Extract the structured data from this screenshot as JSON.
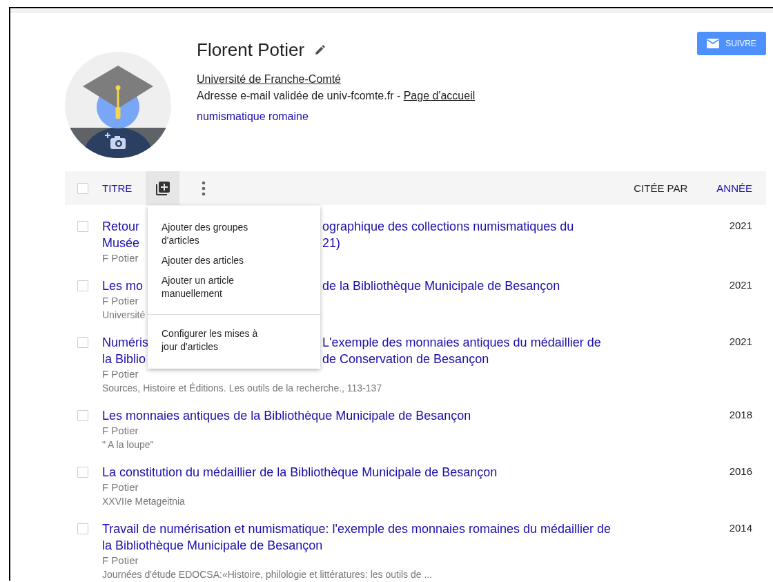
{
  "profile": {
    "name": "Florent Potier",
    "affiliation": "Université de Franche-Comté",
    "email_note": "Adresse e-mail validée de univ-fcomte.fr - ",
    "homepage_link": "Page d'accueil",
    "interest": "numismatique romaine"
  },
  "follow_button": {
    "label": "SUIVRE"
  },
  "table_header": {
    "select_all_checked": false,
    "title": "TITRE",
    "cited_by": "CITÉE PAR",
    "year": "ANNÉE"
  },
  "add_menu": {
    "groups": [
      [
        "Ajouter des groupes d'articles",
        "Ajouter des articles",
        "Ajouter un article manuellement"
      ],
      [
        "Configurer les mises à jour d'articles"
      ]
    ]
  },
  "articles": [
    {
      "checked": false,
      "title_segments": [
        {
          "before": "Retour",
          "after": "ographique des collections numismatiques du"
        },
        {
          "before": "Musée",
          "after": "21)"
        }
      ],
      "authors": "F Potier",
      "year": "2021"
    },
    {
      "checked": false,
      "title_segments": [
        {
          "before": "Les mo",
          "after": "de la Bibliothèque Municipale de Besançon"
        }
      ],
      "authors": "F Potier",
      "venue": "Université",
      "year": "2021"
    },
    {
      "checked": false,
      "title_segments": [
        {
          "before": "Numéris",
          "after": "L'exemple des monnaies antiques du médaillier de"
        },
        {
          "before": "la Biblio",
          "after": "de Conservation de Besançon"
        }
      ],
      "authors": "F Potier",
      "venue": "Sources, Histoire et Éditions. Les outils de la recherche., 113-137",
      "year": "2021"
    },
    {
      "checked": false,
      "title": "Les monnaies antiques de la Bibliothèque Municipale de Besançon",
      "authors": "F Potier",
      "venue": "\" A la loupe\"",
      "year": "2018"
    },
    {
      "checked": false,
      "title": "La constitution du médaillier de la Bibliothèque Municipale de Besançon",
      "authors": "F Potier",
      "venue": "XXVIIe Metageitnia",
      "year": "2016"
    },
    {
      "checked": false,
      "title": "Travail de numérisation et numismatique: l'exemple des monnaies romaines du médaillier de la Bibliothèque Municipale de Besançon",
      "authors": "F Potier",
      "venue": "Journées d'étude EDOCSA:«Histoire, philologie et littératures: les outils de ...",
      "year": "2014"
    }
  ]
}
